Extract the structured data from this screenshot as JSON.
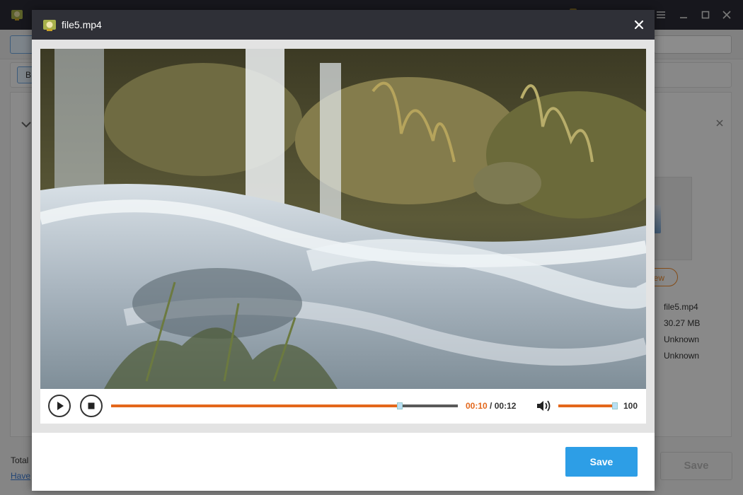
{
  "background_app": {
    "back_label": "B",
    "preview_label": "iew",
    "file_info": [
      "file5.mp4",
      "30.27 MB",
      "Unknown",
      "Unknown"
    ],
    "footer_total": "Total",
    "footer_link": "Have",
    "save_label": "Save"
  },
  "dialog": {
    "title": "file5.mp4",
    "save_label": "Save"
  },
  "player": {
    "current_time": "00:10",
    "separator": " / ",
    "total_time": "00:12",
    "progress_fraction": 0.833,
    "volume": "100",
    "volume_fraction": 1.0
  },
  "icons": {
    "app_logo": "app-logo-icon",
    "dialog_logo": "app-logo-icon",
    "close": "close-icon",
    "play": "play-icon",
    "stop": "stop-icon",
    "volume": "volume-icon"
  },
  "colors": {
    "accent_orange": "#e3671b",
    "save_blue": "#2d9ee6",
    "header_dark": "#2f3037"
  }
}
